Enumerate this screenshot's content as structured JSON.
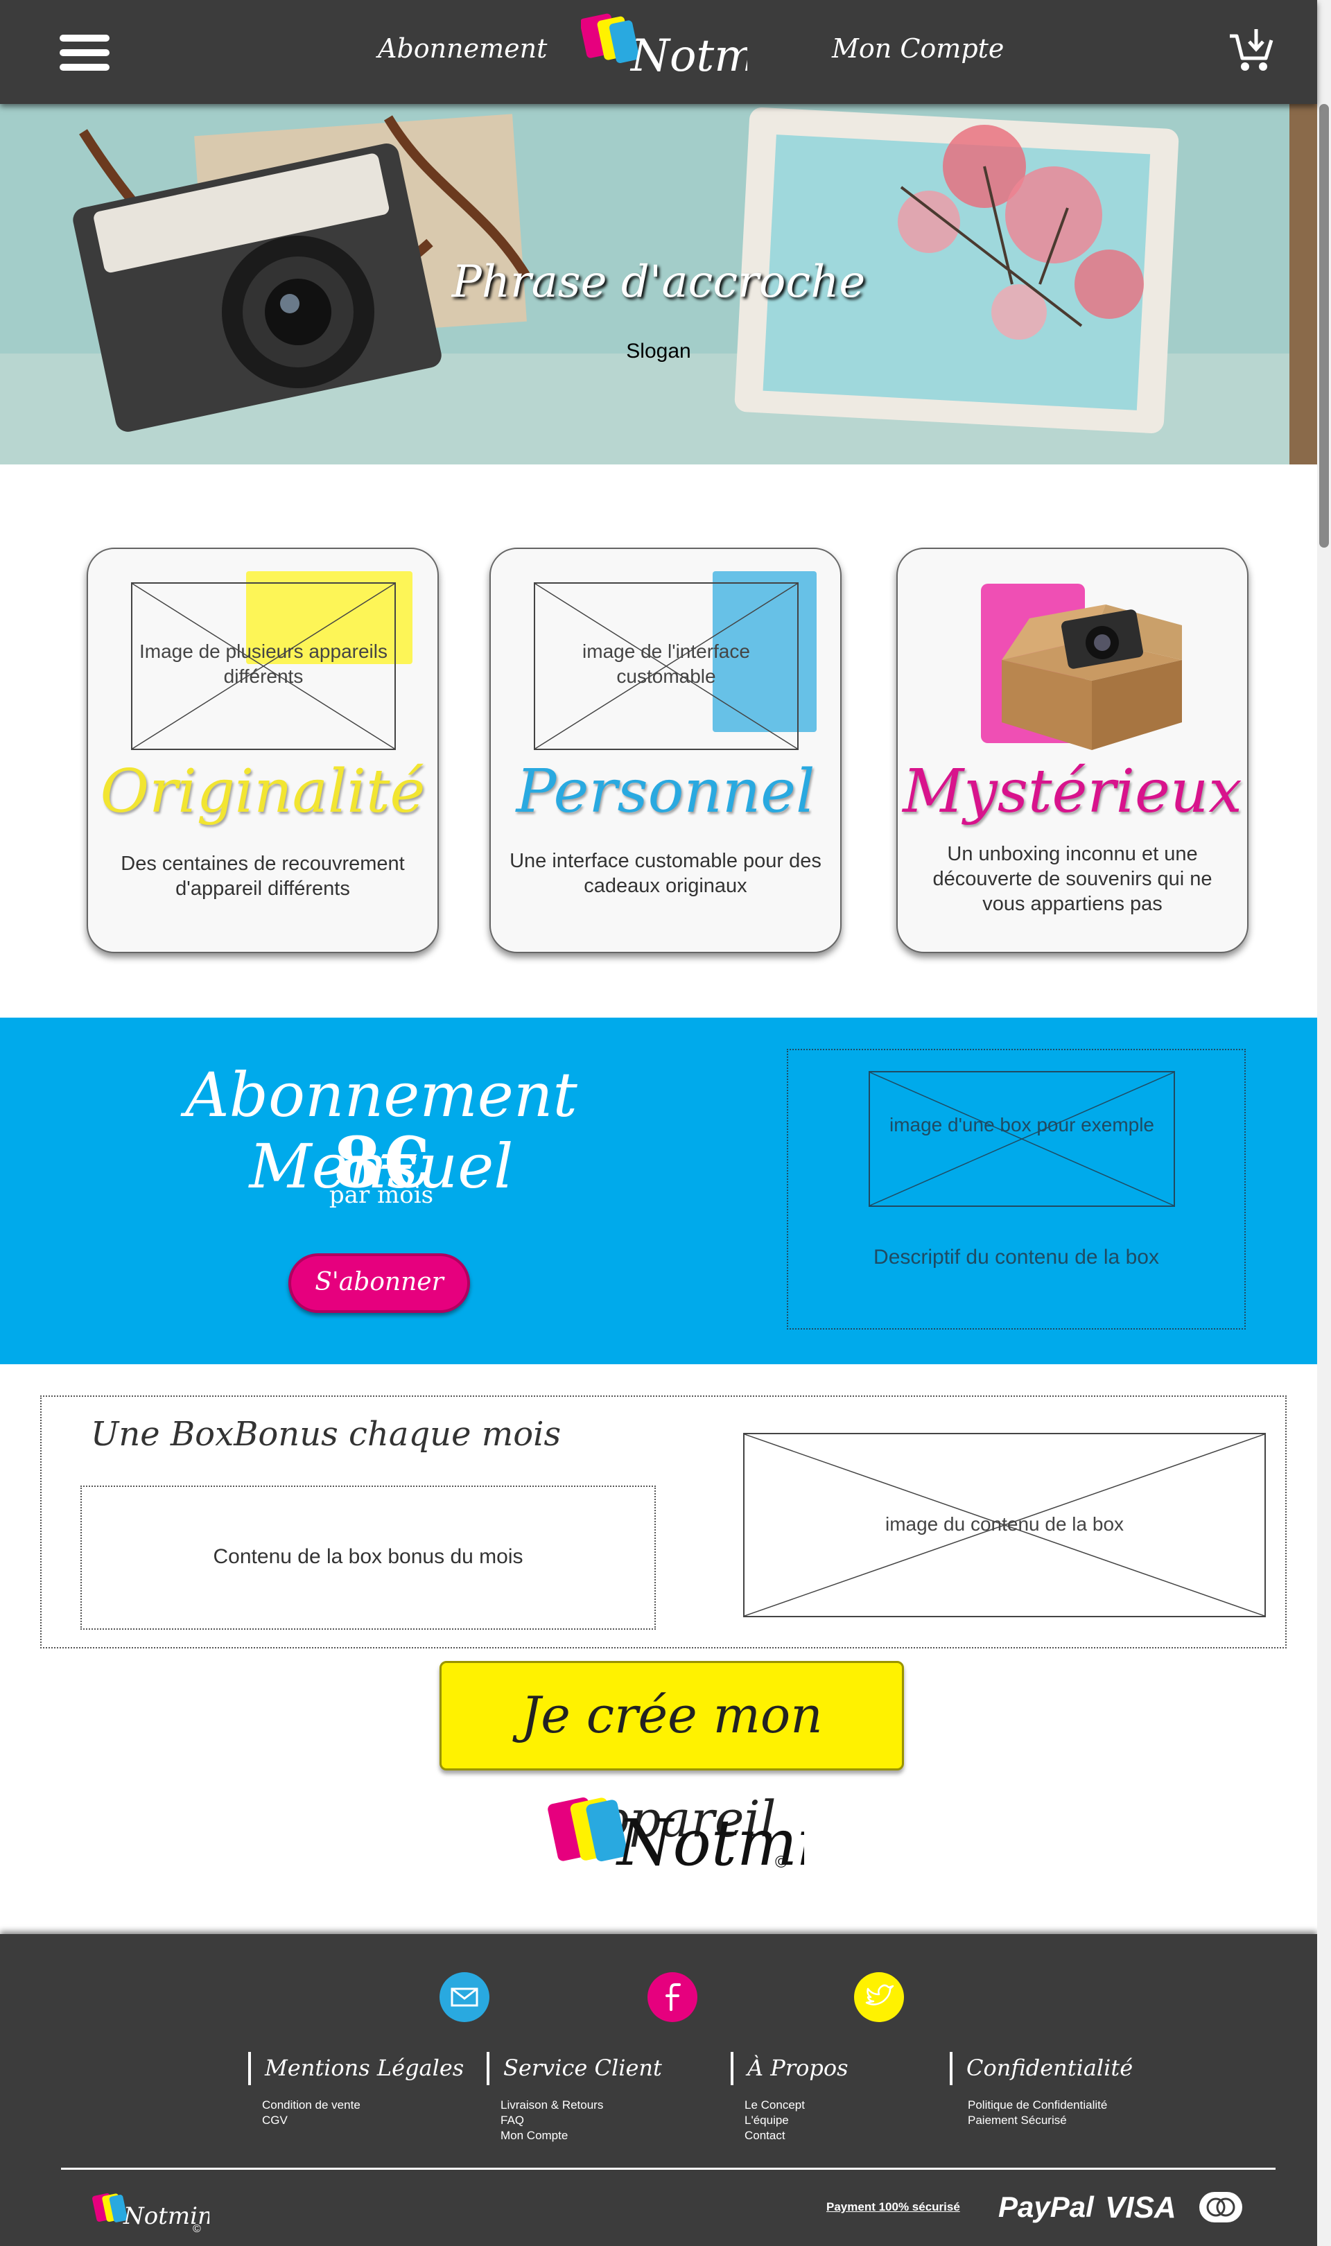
{
  "header": {
    "nav_subscription": "Abonnement",
    "nav_account": "Mon Compte",
    "logo_text": "Notmine"
  },
  "hero": {
    "title": "Phrase d'accroche",
    "slogan": "Slogan"
  },
  "features": [
    {
      "image_text": "Image de plusieurs appareils différents",
      "title": "Originalité",
      "title_color": "#f2e531",
      "description": "Des centaines de recouvrement d'appareil différents"
    },
    {
      "image_text": "image de l'interface customable",
      "title": "Personnel",
      "title_color": "#29a9e0",
      "description": "Une interface customable pour des cadeaux originaux"
    },
    {
      "title": "Mystérieux",
      "title_color": "#d8138c",
      "description": "Un unboxing inconnu et une découverte de souvenirs qui ne vous appartiens pas"
    }
  ],
  "subscription": {
    "title": "Abonnement Mensuel",
    "price": "8€",
    "period": "par mois",
    "button": "S'abonner",
    "image_text": "image d'une box pour exemple",
    "description": "Descriptif du contenu de la box",
    "bg_color": "#00aaeb",
    "button_color": "#e6007e"
  },
  "bonus": {
    "title": "Une BoxBonus chaque mois",
    "content": "Contenu de la box bonus du mois",
    "image_text": "image du contenu de la box"
  },
  "cta": {
    "label": "Je crée mon appareil",
    "color": "#fff200"
  },
  "brand": {
    "logo_text": "Notmine",
    "copyright": "©"
  },
  "footer": {
    "social": [
      {
        "icon": "mail-icon",
        "color": "#29a9e0"
      },
      {
        "icon": "facebook-icon",
        "color": "#e6007e"
      },
      {
        "icon": "twitter-icon",
        "color": "#fff200"
      }
    ],
    "columns": [
      {
        "heading": "Mentions Légales",
        "links": [
          "Condition de vente",
          "CGV"
        ]
      },
      {
        "heading": "Service Client",
        "links": [
          "Livraison & Retours",
          "FAQ",
          "Mon Compte"
        ]
      },
      {
        "heading": "À Propos",
        "links": [
          "Le Concept",
          "L'équipe",
          "Contact"
        ]
      },
      {
        "heading": "Confidentialité",
        "links": [
          "Politique de Confidentialité",
          "Paiement Sécurisé"
        ]
      }
    ],
    "payment_label": "Payment 100% sécurisé",
    "payment_methods": [
      "PayPal",
      "VISA"
    ],
    "logo_text": "Notmine",
    "copyright": "©"
  }
}
